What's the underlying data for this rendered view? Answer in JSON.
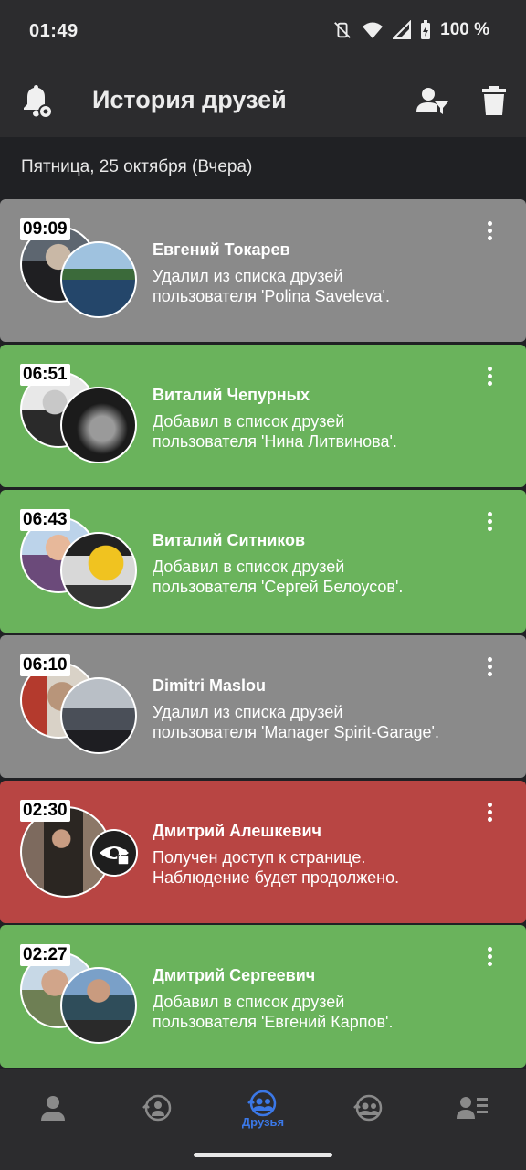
{
  "status": {
    "time": "01:49",
    "battery": "100 %"
  },
  "appbar": {
    "title": "История друзей"
  },
  "date_header": "Пятница, 25 октября (Вчера)",
  "cards": [
    {
      "time": "09:09",
      "name": "Евгений Токарев",
      "line1": "Удалил из списка друзей",
      "line2": "пользователя 'Polina Saveleva'.",
      "color": "#8a8a8a"
    },
    {
      "time": "06:51",
      "name": "Виталий Чепурных",
      "line1": "Добавил в список друзей",
      "line2": "пользователя 'Нина Литвинова'.",
      "color": "#6ab35c"
    },
    {
      "time": "06:43",
      "name": "Виталий Ситников",
      "line1": "Добавил в список друзей",
      "line2": "пользователя 'Сергей Белоусов'.",
      "color": "#6ab35c"
    },
    {
      "time": "06:10",
      "name": "Dimitri Maslou",
      "line1": "Удалил из списка друзей",
      "line2": "пользователя 'Manager Spirit-Garage'.",
      "color": "#8a8a8a"
    },
    {
      "time": "02:30",
      "name": "Дмитрий Алешкевич",
      "line1": "Получен доступ к странице.",
      "line2": "Наблюдение будет продолжено.",
      "color": "#b84543"
    },
    {
      "time": "02:27",
      "name": "Дмитрий Сергеевич",
      "line1": "Добавил в список друзей",
      "line2": "пользователя 'Евгений Карпов'.",
      "color": "#6ab35c"
    }
  ],
  "bottom_nav": {
    "items": [
      "person-icon",
      "history-person-icon",
      "friends-icon",
      "group-history-icon",
      "list-person-icon"
    ],
    "active_label": "Друзья",
    "active_color": "#3b78e7"
  }
}
